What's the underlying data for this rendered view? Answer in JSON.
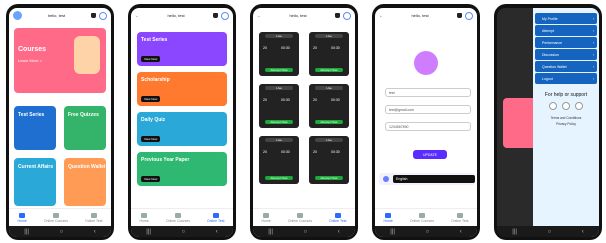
{
  "user_greeting": "hello, test",
  "phones": [
    {
      "id": "home",
      "courses": {
        "title": "Courses",
        "cta": "Learn More >"
      },
      "tiles": [
        {
          "title": "Test Series"
        },
        {
          "title": "Free Quizzes"
        },
        {
          "title": "Current Affairs"
        },
        {
          "title": "Question Wallet"
        }
      ],
      "tabs": [
        {
          "label": "Home",
          "active": true
        },
        {
          "label": "Online Courses",
          "active": false
        },
        {
          "label": "Online Test",
          "active": false
        }
      ]
    },
    {
      "id": "categories",
      "cards": [
        {
          "title": "Test Series",
          "cta": "View Now",
          "color": "#8b46ff"
        },
        {
          "title": "Scholarship",
          "cta": "View Now",
          "color": "#ff7a2f"
        },
        {
          "title": "Daily Quiz",
          "cta": "View Now",
          "color": "#2aa8d8"
        },
        {
          "title": "Previous Year Paper",
          "cta": "View Now",
          "color": "#2eb872"
        }
      ],
      "tabs": [
        {
          "label": "Home",
          "active": false
        },
        {
          "label": "Online Courses",
          "active": false
        },
        {
          "label": "Online Test",
          "active": true
        }
      ]
    },
    {
      "id": "tests",
      "cards": [
        {
          "label": "Live",
          "a": "20",
          "b": "00:30",
          "cta": "Attempt Now"
        },
        {
          "label": "Live",
          "a": "20",
          "b": "00:30",
          "cta": "Attempt Now"
        },
        {
          "label": "Live",
          "a": "20",
          "b": "00:30",
          "cta": "Attempt Now"
        },
        {
          "label": "Live",
          "a": "20",
          "b": "00:30",
          "cta": "Attempt Now"
        },
        {
          "label": "Live",
          "a": "20",
          "b": "00:30",
          "cta": "Attempt Now"
        },
        {
          "label": "Live",
          "a": "20",
          "b": "00:30",
          "cta": "Attempt Now"
        }
      ],
      "tabs": [
        {
          "label": "Home",
          "active": false
        },
        {
          "label": "Online Courses",
          "active": false
        },
        {
          "label": "Online Test",
          "active": true
        }
      ]
    },
    {
      "id": "profile",
      "fields": [
        "test",
        "test@gmail.com",
        "1234567890"
      ],
      "update": "UPDATE",
      "language": "English",
      "tabs": [
        {
          "label": "Home",
          "active": true
        },
        {
          "label": "Online Courses",
          "active": false
        },
        {
          "label": "Online Test",
          "active": false
        }
      ]
    },
    {
      "id": "drawer",
      "menu": [
        "My Profile",
        "Attempt",
        "Performance",
        "Discussion",
        "Question Wallet",
        "Logout"
      ],
      "help": "For help or support",
      "terms": "Terms and Conditions",
      "privacy": "Privacy Policy"
    }
  ]
}
